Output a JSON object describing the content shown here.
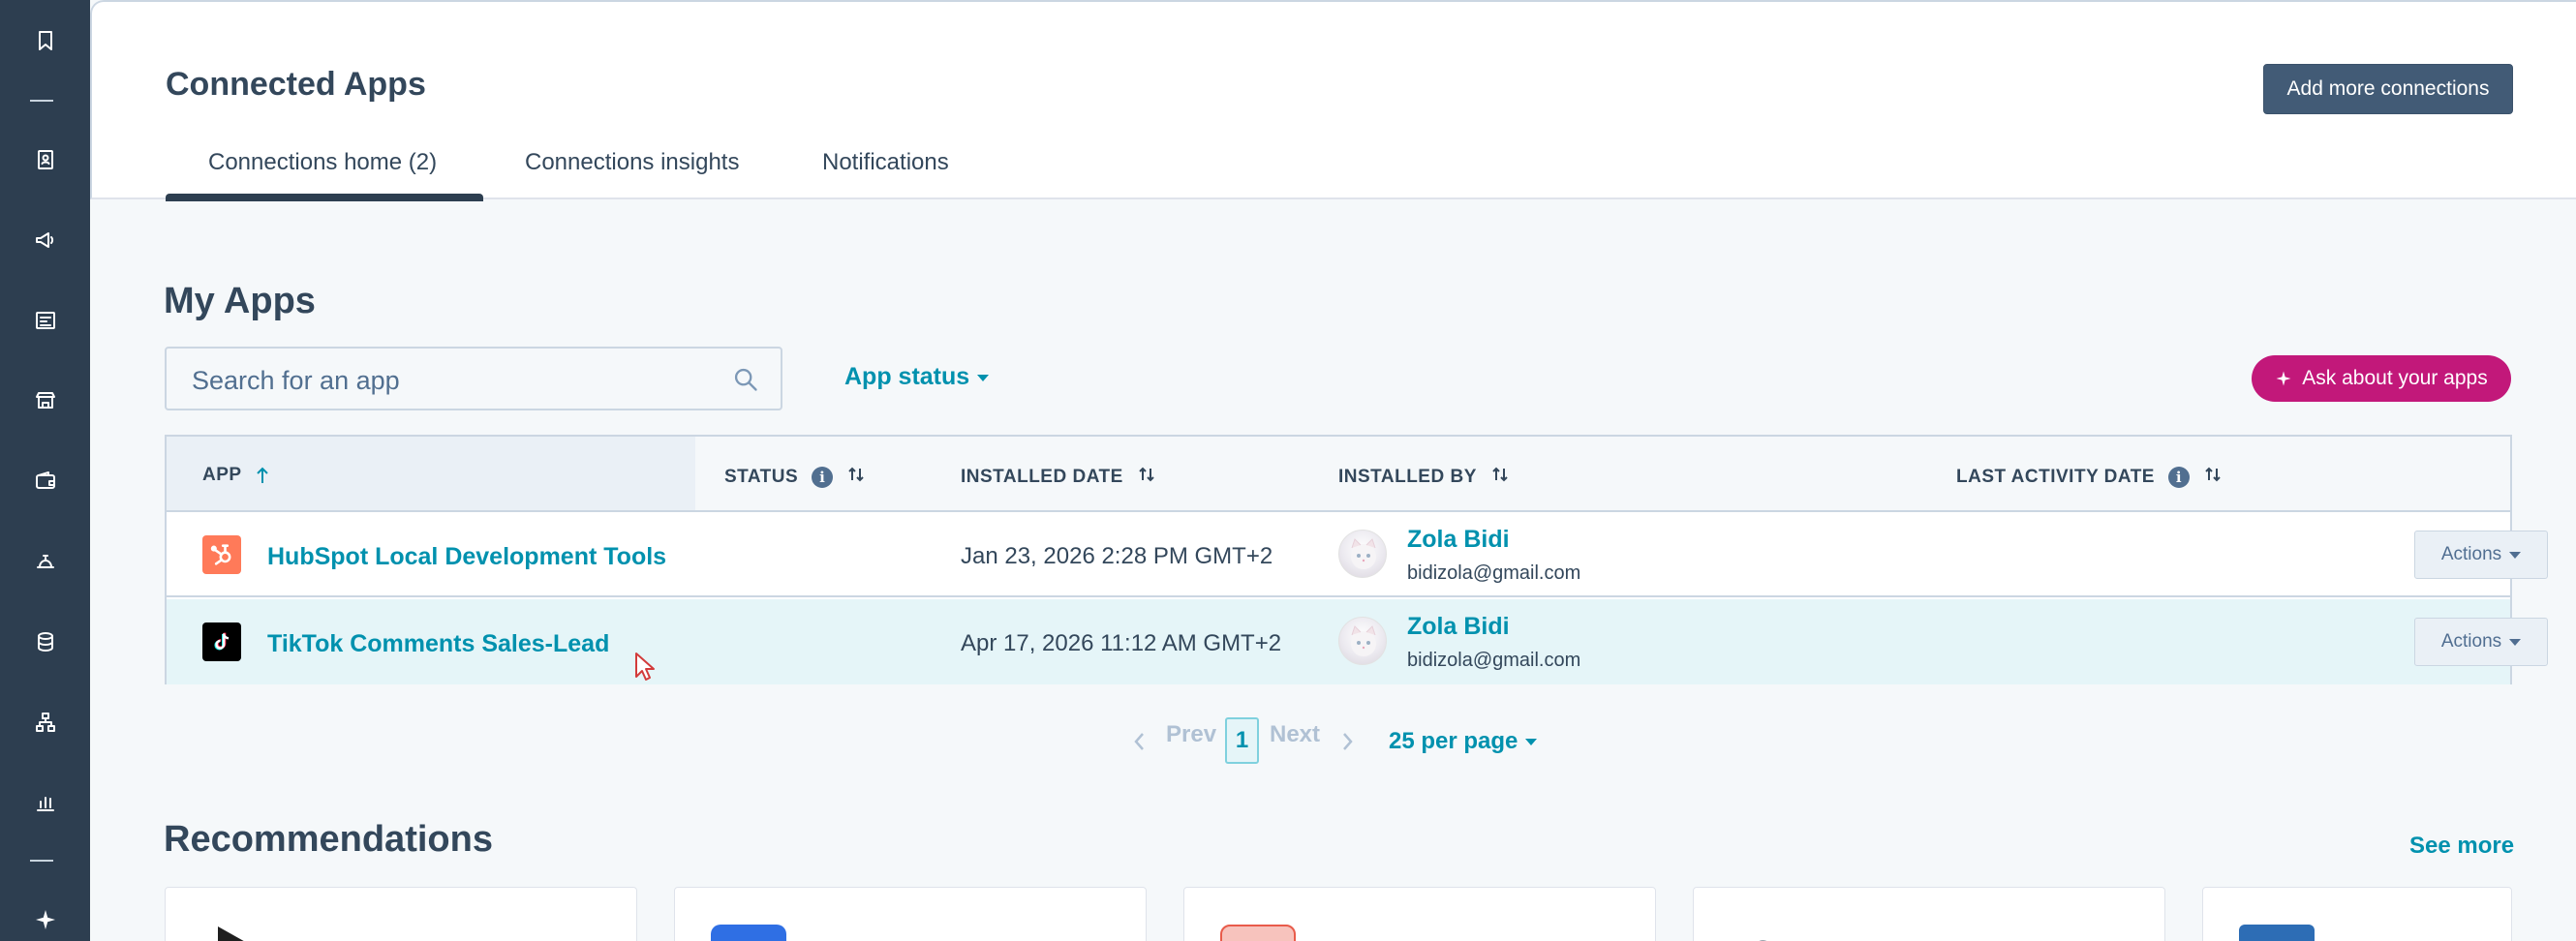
{
  "header": {
    "title": "Connected Apps",
    "add_button": "Add more connections",
    "tabs": [
      {
        "label": "Connections home (2)"
      },
      {
        "label": "Connections insights"
      },
      {
        "label": "Notifications"
      }
    ]
  },
  "my_apps": {
    "title": "My Apps",
    "search_placeholder": "Search for an app",
    "status_filter": "App status",
    "ask_button": "Ask about your apps"
  },
  "table": {
    "columns": {
      "app": "APP",
      "status": "STATUS",
      "installed_date": "INSTALLED DATE",
      "installed_by": "INSTALLED BY",
      "last_activity": "LAST ACTIVITY DATE"
    },
    "rows": [
      {
        "app": "HubSpot Local Development Tools",
        "installed_date": "Jan 23, 2026 2:28 PM GMT+2",
        "user_name": "Zola Bidi",
        "user_email": "bidizola@gmail.com",
        "actions": "Actions"
      },
      {
        "app": "TikTok Comments Sales-Lead",
        "installed_date": "Apr 17, 2026 11:12 AM GMT+2",
        "user_name": "Zola Bidi",
        "user_email": "bidizola@gmail.com",
        "actions": "Actions"
      }
    ]
  },
  "pagination": {
    "prev": "Prev",
    "current": "1",
    "next": "Next",
    "per_page": "25 per page"
  },
  "recommendations": {
    "title": "Recommendations",
    "see_more": "See more"
  },
  "colors": {
    "sidebar": "#2d3e50",
    "link": "#0091ae",
    "primary_button": "#425b76",
    "ask_button": "#c2187a",
    "hubspot_orange": "#ff7a59"
  }
}
